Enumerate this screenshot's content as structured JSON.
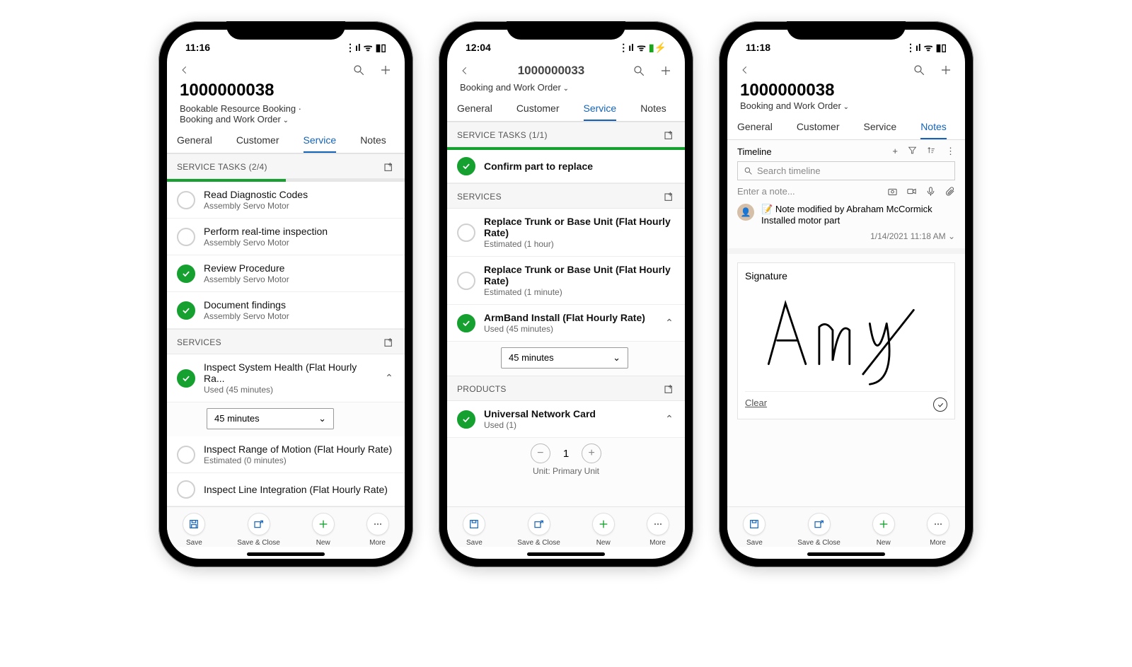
{
  "phone1": {
    "time": "11:16",
    "header": {
      "title": "1000000038",
      "subtitle": "Bookable Resource Booking  ·",
      "form": "Booking and Work Order"
    },
    "tabs": {
      "general": "General",
      "customer": "Customer",
      "service": "Service",
      "notes": "Notes",
      "active": "Service"
    },
    "serviceTasks": {
      "label": "SERVICE TASKS (2/4)",
      "progressPct": 50,
      "items": [
        {
          "title": "Read Diagnostic Codes",
          "sub": "Assembly Servo Motor",
          "done": false
        },
        {
          "title": "Perform real-time inspection",
          "sub": "Assembly Servo Motor",
          "done": false
        },
        {
          "title": "Review Procedure",
          "sub": "Assembly Servo Motor",
          "done": true
        },
        {
          "title": "Document findings",
          "sub": "Assembly Servo Motor",
          "done": true
        }
      ]
    },
    "services": {
      "label": "SERVICES",
      "items": [
        {
          "title": "Inspect System Health (Flat Hourly Ra...",
          "sub": "Used (45 minutes)",
          "done": true,
          "expanded": true,
          "duration": "45 minutes"
        },
        {
          "title": "Inspect Range of Motion (Flat Hourly Rate)",
          "sub": "Estimated (0 minutes)",
          "done": false
        },
        {
          "title": "Inspect Line Integration (Flat Hourly Rate)",
          "sub": "",
          "done": false
        }
      ]
    }
  },
  "phone2": {
    "time": "12:04",
    "header": {
      "title": "1000000033",
      "form": "Booking and Work Order"
    },
    "tabs": {
      "general": "General",
      "customer": "Customer",
      "service": "Service",
      "notes": "Notes",
      "active": "Service"
    },
    "serviceTasks": {
      "label": "SERVICE TASKS (1/1)",
      "progressPct": 100,
      "items": [
        {
          "title": "Confirm part to replace",
          "sub": "",
          "done": true
        }
      ]
    },
    "services": {
      "label": "SERVICES",
      "items": [
        {
          "title": "Replace Trunk or Base Unit (Flat Hourly Rate)",
          "sub": "Estimated (1 hour)",
          "done": false
        },
        {
          "title": "Replace Trunk or Base Unit (Flat Hourly Rate)",
          "sub": "Estimated (1 minute)",
          "done": false
        },
        {
          "title": "ArmBand Install (Flat Hourly Rate)",
          "sub": "Used (45 minutes)",
          "done": true,
          "expanded": true,
          "duration": "45 minutes"
        }
      ]
    },
    "products": {
      "label": "PRODUCTS",
      "items": [
        {
          "title": "Universal Network Card",
          "sub": "Used (1)",
          "done": true,
          "qty": "1",
          "unit": "Unit: Primary Unit"
        }
      ]
    }
  },
  "phone3": {
    "time": "11:18",
    "header": {
      "title": "1000000038",
      "form": "Booking and Work Order"
    },
    "tabs": {
      "general": "General",
      "customer": "Customer",
      "service": "Service",
      "notes": "Notes",
      "active": "Notes"
    },
    "timeline": {
      "label": "Timeline",
      "searchPlaceholder": "Search timeline",
      "notePlaceholder": "Enter a note...",
      "entry": {
        "title": "Note modified by Abraham McCormick",
        "body": "Installed motor part",
        "meta": "1/14/2021 11:18 AM"
      }
    },
    "signature": {
      "label": "Signature",
      "clear": "Clear"
    }
  },
  "bottomBar": {
    "save": "Save",
    "saveClose": "Save & Close",
    "new": "New",
    "more": "More"
  }
}
